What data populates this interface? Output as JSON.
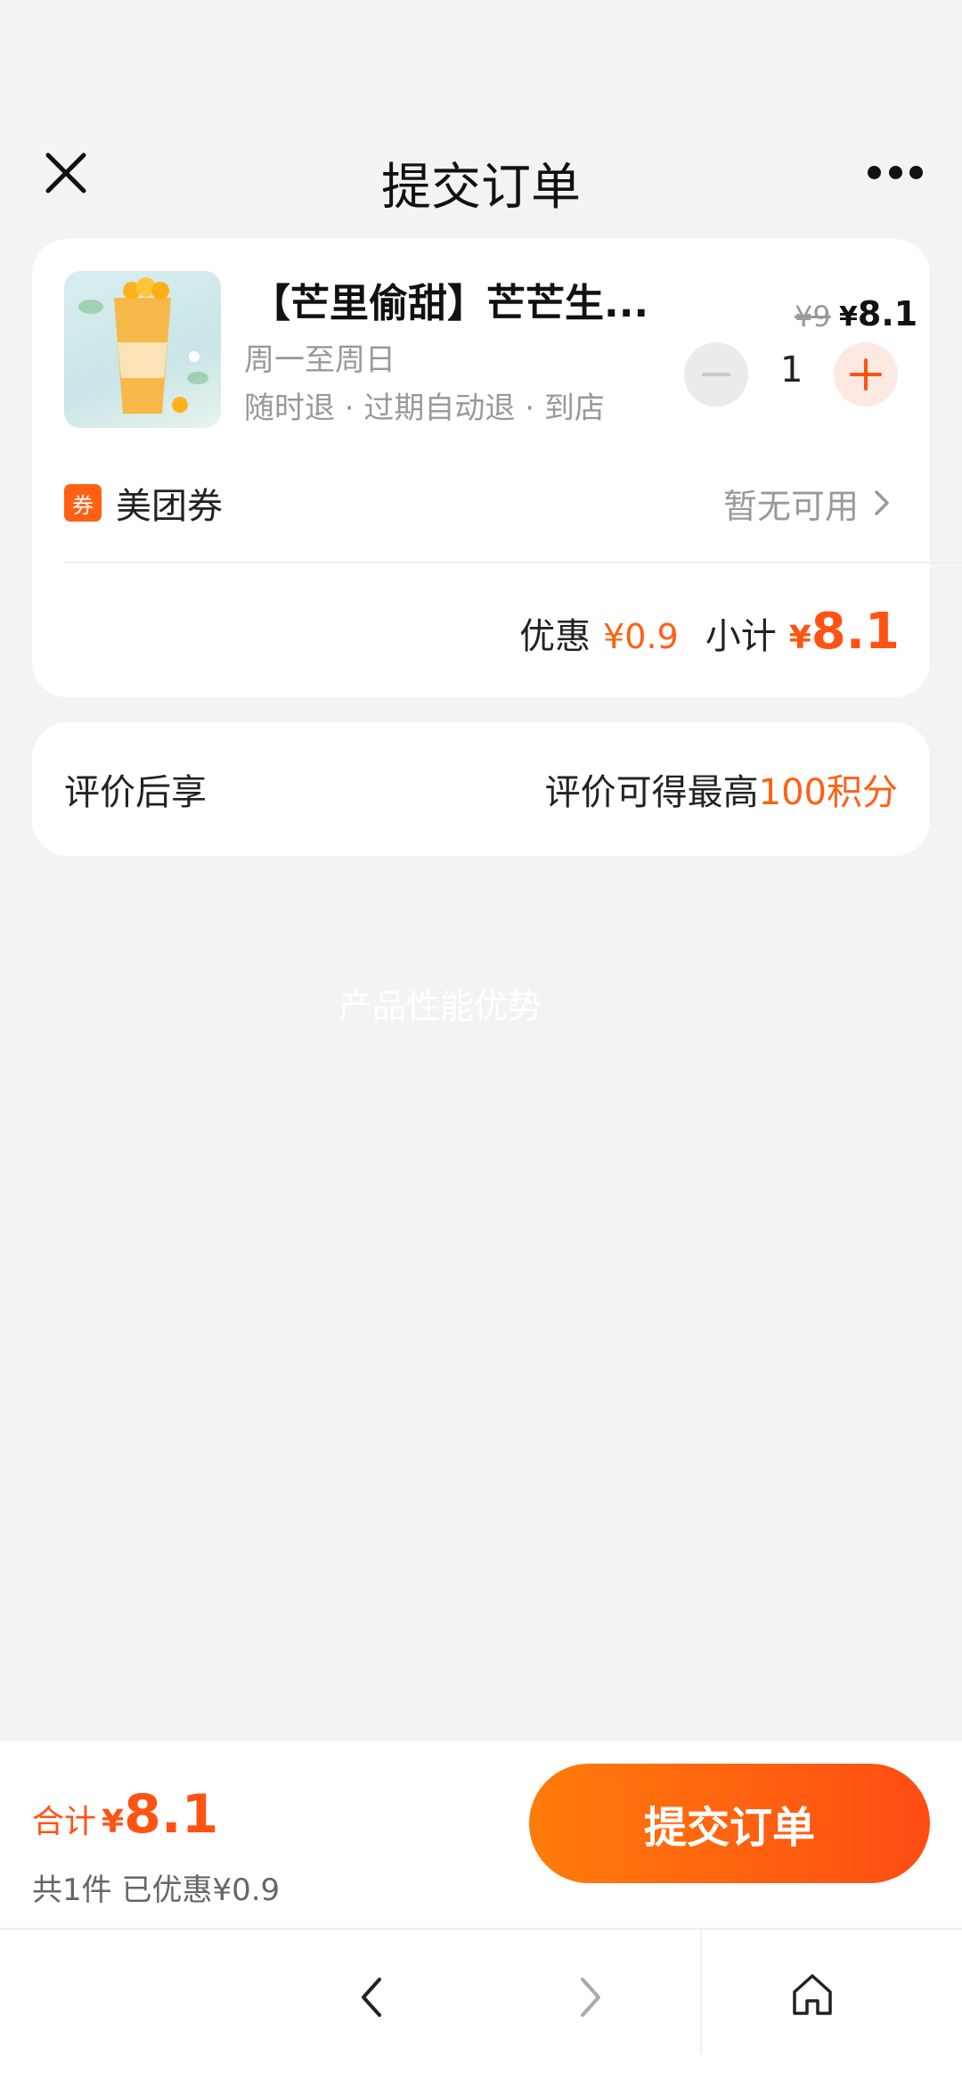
{
  "nav": {
    "title": "提交订单"
  },
  "order": {
    "product_name": "【芒里偷甜】芒芒生...",
    "days": "周一至周日",
    "refund": "随时退 · 过期自动退 · 到店",
    "price_original": "¥9",
    "price_yen": "¥",
    "price_now": "8.1",
    "quantity": "1",
    "coupon_badge": "券",
    "coupon_label": "美团券",
    "coupon_status": "暂无可用",
    "discount_label": "优惠",
    "discount_value": "¥0.9",
    "subtotal_label": "小计",
    "subtotal_yen": "¥",
    "subtotal_value": "8.1"
  },
  "review": {
    "left": "评价后享",
    "right_prefix": "评价可得最高",
    "right_highlight": "100积分"
  },
  "watermark": "产品性能优势",
  "bottom": {
    "total_label": "合计",
    "total_yen": "¥",
    "total_value": "8.1",
    "summary": "共1件  已优惠¥0.9",
    "submit_label": "提交订单"
  },
  "colors": {
    "accent": "#ff6013",
    "button_start": "#ff7c0a",
    "button_end": "#ff4c14"
  }
}
